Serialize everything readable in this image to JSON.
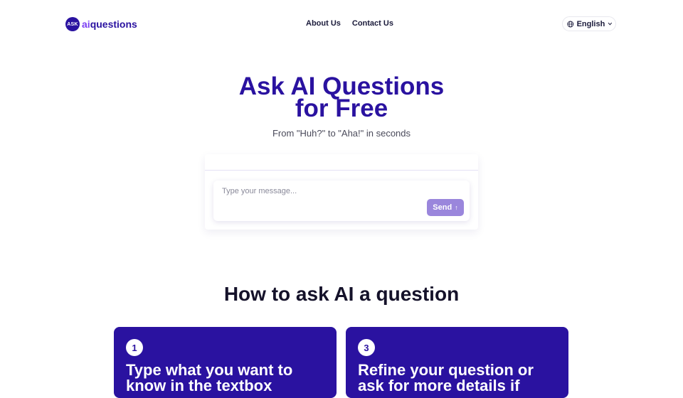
{
  "header": {
    "logo_badge": "ASK",
    "logo_ai": "ai",
    "logo_rest": "questions",
    "nav": [
      {
        "label": "About Us"
      },
      {
        "label": "Contact Us"
      }
    ],
    "language": "English"
  },
  "hero": {
    "title_line1": "Ask AI Questions",
    "title_line2": "for Free",
    "subtitle": "From \"Huh?\" to \"Aha!\" in seconds"
  },
  "chat": {
    "placeholder": "Type your message...",
    "send_label": "Send"
  },
  "howto": {
    "title": "How to ask AI a question",
    "steps": [
      {
        "number": "1",
        "text": "Type what you want to know in the textbox"
      },
      {
        "number": "3",
        "text": "Refine your question or ask for more details if"
      }
    ]
  },
  "colors": {
    "brand": "#2a12a0",
    "accent": "#7b3ff2",
    "send_button": "#9a86dc"
  }
}
